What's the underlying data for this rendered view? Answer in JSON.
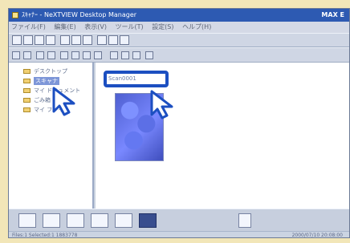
{
  "window": {
    "title": "ｽｷｬﾅｰ - NeXTVIEW Desktop Manager",
    "title_right": "MAX E"
  },
  "menu": [
    {
      "label": "ファイル(F)"
    },
    {
      "label": "編集(E)"
    },
    {
      "label": "表示(V)"
    },
    {
      "label": "ツール(T)"
    },
    {
      "label": "設定(S)"
    },
    {
      "label": "ヘルプ(H)"
    }
  ],
  "tree": {
    "items": [
      {
        "label": "デスクトップ"
      },
      {
        "label": "スキャナ"
      },
      {
        "label": "マイ ドキュメント"
      },
      {
        "label": "ごみ箱"
      },
      {
        "label": "マイ ファイル"
      }
    ]
  },
  "thumbnail": {
    "title": "Scan0001"
  },
  "status": {
    "left": "Files:1 Selected:1  1883778",
    "right": "2000/07/10 20:08:00"
  }
}
